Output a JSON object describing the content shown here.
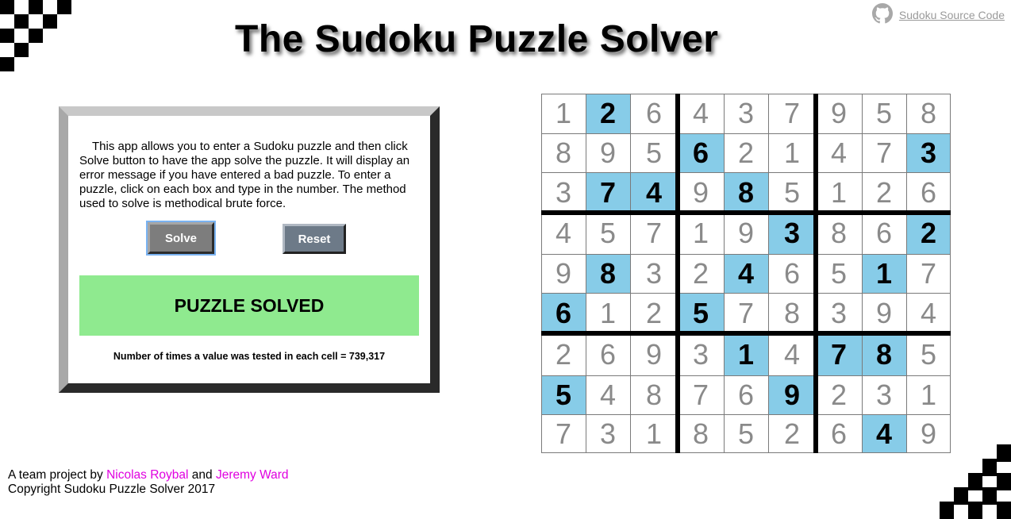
{
  "header": {
    "title": "The Sudoku Puzzle Solver",
    "source_link": "Sudoku Source Code",
    "source_icon": "github-icon"
  },
  "panel": {
    "intro": "This app allows you to enter a Sudoku puzzle and then click Solve button to have the app solve the puzzle. It will display an error message if you have entered a bad puzzle. To enter a puzzle, click on each box and type in the number. The method used to solve is methodical brute force.",
    "solve_label": "Solve",
    "reset_label": "Reset",
    "status": "PUZZLE SOLVED",
    "tests": "Number of times a value was tested in each cell = 739,317"
  },
  "grid": {
    "rows": [
      [
        1,
        2,
        6,
        4,
        3,
        7,
        9,
        5,
        8
      ],
      [
        8,
        9,
        5,
        6,
        2,
        1,
        4,
        7,
        3
      ],
      [
        3,
        7,
        4,
        9,
        8,
        5,
        1,
        2,
        6
      ],
      [
        4,
        5,
        7,
        1,
        9,
        3,
        8,
        6,
        2
      ],
      [
        9,
        8,
        3,
        2,
        4,
        6,
        5,
        1,
        7
      ],
      [
        6,
        1,
        2,
        5,
        7,
        8,
        3,
        9,
        4
      ],
      [
        2,
        6,
        9,
        3,
        1,
        4,
        7,
        8,
        5
      ],
      [
        5,
        4,
        8,
        7,
        6,
        9,
        2,
        3,
        1
      ],
      [
        7,
        3,
        1,
        8,
        5,
        2,
        6,
        4,
        9
      ]
    ],
    "given": [
      [
        0,
        1,
        0,
        0,
        0,
        0,
        0,
        0,
        0
      ],
      [
        0,
        0,
        0,
        1,
        0,
        0,
        0,
        0,
        1
      ],
      [
        0,
        1,
        1,
        0,
        1,
        0,
        0,
        0,
        0
      ],
      [
        0,
        0,
        0,
        0,
        0,
        1,
        0,
        0,
        1
      ],
      [
        0,
        1,
        0,
        0,
        1,
        0,
        0,
        1,
        0
      ],
      [
        1,
        0,
        0,
        1,
        0,
        0,
        0,
        0,
        0
      ],
      [
        0,
        0,
        0,
        0,
        1,
        0,
        1,
        1,
        0
      ],
      [
        1,
        0,
        0,
        0,
        0,
        1,
        0,
        0,
        0
      ],
      [
        0,
        0,
        0,
        0,
        0,
        0,
        0,
        1,
        0
      ]
    ],
    "given_color": "#87cce8",
    "solved_color": "#8a8a8a"
  },
  "footer": {
    "prefix": "A team project by",
    "author1": "Nicolas Roybal",
    "and": "and",
    "author2": "Jeremy Ward",
    "copyright": "Copyright Sudoku Puzzle Solver 2017",
    "author_color": "#e000e0"
  },
  "colors": {
    "status_bg": "#8fea8f",
    "solve_button": "#7d7d7d",
    "reset_button": "#6d7a88"
  }
}
